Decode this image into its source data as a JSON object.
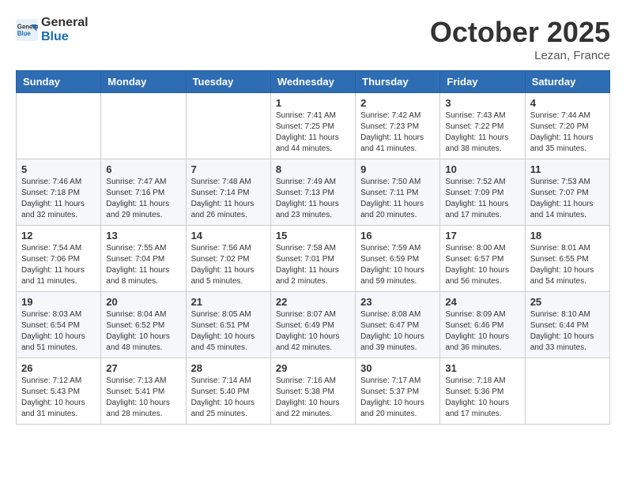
{
  "logo": {
    "line1": "General",
    "line2": "Blue"
  },
  "title": "October 2025",
  "location": "Lezan, France",
  "days_header": [
    "Sunday",
    "Monday",
    "Tuesday",
    "Wednesday",
    "Thursday",
    "Friday",
    "Saturday"
  ],
  "weeks": [
    [
      {
        "day": "",
        "info": ""
      },
      {
        "day": "",
        "info": ""
      },
      {
        "day": "",
        "info": ""
      },
      {
        "day": "1",
        "info": "Sunrise: 7:41 AM\nSunset: 7:25 PM\nDaylight: 11 hours and 44 minutes."
      },
      {
        "day": "2",
        "info": "Sunrise: 7:42 AM\nSunset: 7:23 PM\nDaylight: 11 hours and 41 minutes."
      },
      {
        "day": "3",
        "info": "Sunrise: 7:43 AM\nSunset: 7:22 PM\nDaylight: 11 hours and 38 minutes."
      },
      {
        "day": "4",
        "info": "Sunrise: 7:44 AM\nSunset: 7:20 PM\nDaylight: 11 hours and 35 minutes."
      }
    ],
    [
      {
        "day": "5",
        "info": "Sunrise: 7:46 AM\nSunset: 7:18 PM\nDaylight: 11 hours and 32 minutes."
      },
      {
        "day": "6",
        "info": "Sunrise: 7:47 AM\nSunset: 7:16 PM\nDaylight: 11 hours and 29 minutes."
      },
      {
        "day": "7",
        "info": "Sunrise: 7:48 AM\nSunset: 7:14 PM\nDaylight: 11 hours and 26 minutes."
      },
      {
        "day": "8",
        "info": "Sunrise: 7:49 AM\nSunset: 7:13 PM\nDaylight: 11 hours and 23 minutes."
      },
      {
        "day": "9",
        "info": "Sunrise: 7:50 AM\nSunset: 7:11 PM\nDaylight: 11 hours and 20 minutes."
      },
      {
        "day": "10",
        "info": "Sunrise: 7:52 AM\nSunset: 7:09 PM\nDaylight: 11 hours and 17 minutes."
      },
      {
        "day": "11",
        "info": "Sunrise: 7:53 AM\nSunset: 7:07 PM\nDaylight: 11 hours and 14 minutes."
      }
    ],
    [
      {
        "day": "12",
        "info": "Sunrise: 7:54 AM\nSunset: 7:06 PM\nDaylight: 11 hours and 11 minutes."
      },
      {
        "day": "13",
        "info": "Sunrise: 7:55 AM\nSunset: 7:04 PM\nDaylight: 11 hours and 8 minutes."
      },
      {
        "day": "14",
        "info": "Sunrise: 7:56 AM\nSunset: 7:02 PM\nDaylight: 11 hours and 5 minutes."
      },
      {
        "day": "15",
        "info": "Sunrise: 7:58 AM\nSunset: 7:01 PM\nDaylight: 11 hours and 2 minutes."
      },
      {
        "day": "16",
        "info": "Sunrise: 7:59 AM\nSunset: 6:59 PM\nDaylight: 10 hours and 59 minutes."
      },
      {
        "day": "17",
        "info": "Sunrise: 8:00 AM\nSunset: 6:57 PM\nDaylight: 10 hours and 56 minutes."
      },
      {
        "day": "18",
        "info": "Sunrise: 8:01 AM\nSunset: 6:55 PM\nDaylight: 10 hours and 54 minutes."
      }
    ],
    [
      {
        "day": "19",
        "info": "Sunrise: 8:03 AM\nSunset: 6:54 PM\nDaylight: 10 hours and 51 minutes."
      },
      {
        "day": "20",
        "info": "Sunrise: 8:04 AM\nSunset: 6:52 PM\nDaylight: 10 hours and 48 minutes."
      },
      {
        "day": "21",
        "info": "Sunrise: 8:05 AM\nSunset: 6:51 PM\nDaylight: 10 hours and 45 minutes."
      },
      {
        "day": "22",
        "info": "Sunrise: 8:07 AM\nSunset: 6:49 PM\nDaylight: 10 hours and 42 minutes."
      },
      {
        "day": "23",
        "info": "Sunrise: 8:08 AM\nSunset: 6:47 PM\nDaylight: 10 hours and 39 minutes."
      },
      {
        "day": "24",
        "info": "Sunrise: 8:09 AM\nSunset: 6:46 PM\nDaylight: 10 hours and 36 minutes."
      },
      {
        "day": "25",
        "info": "Sunrise: 8:10 AM\nSunset: 6:44 PM\nDaylight: 10 hours and 33 minutes."
      }
    ],
    [
      {
        "day": "26",
        "info": "Sunrise: 7:12 AM\nSunset: 5:43 PM\nDaylight: 10 hours and 31 minutes."
      },
      {
        "day": "27",
        "info": "Sunrise: 7:13 AM\nSunset: 5:41 PM\nDaylight: 10 hours and 28 minutes."
      },
      {
        "day": "28",
        "info": "Sunrise: 7:14 AM\nSunset: 5:40 PM\nDaylight: 10 hours and 25 minutes."
      },
      {
        "day": "29",
        "info": "Sunrise: 7:16 AM\nSunset: 5:38 PM\nDaylight: 10 hours and 22 minutes."
      },
      {
        "day": "30",
        "info": "Sunrise: 7:17 AM\nSunset: 5:37 PM\nDaylight: 10 hours and 20 minutes."
      },
      {
        "day": "31",
        "info": "Sunrise: 7:18 AM\nSunset: 5:36 PM\nDaylight: 10 hours and 17 minutes."
      },
      {
        "day": "",
        "info": ""
      }
    ]
  ]
}
